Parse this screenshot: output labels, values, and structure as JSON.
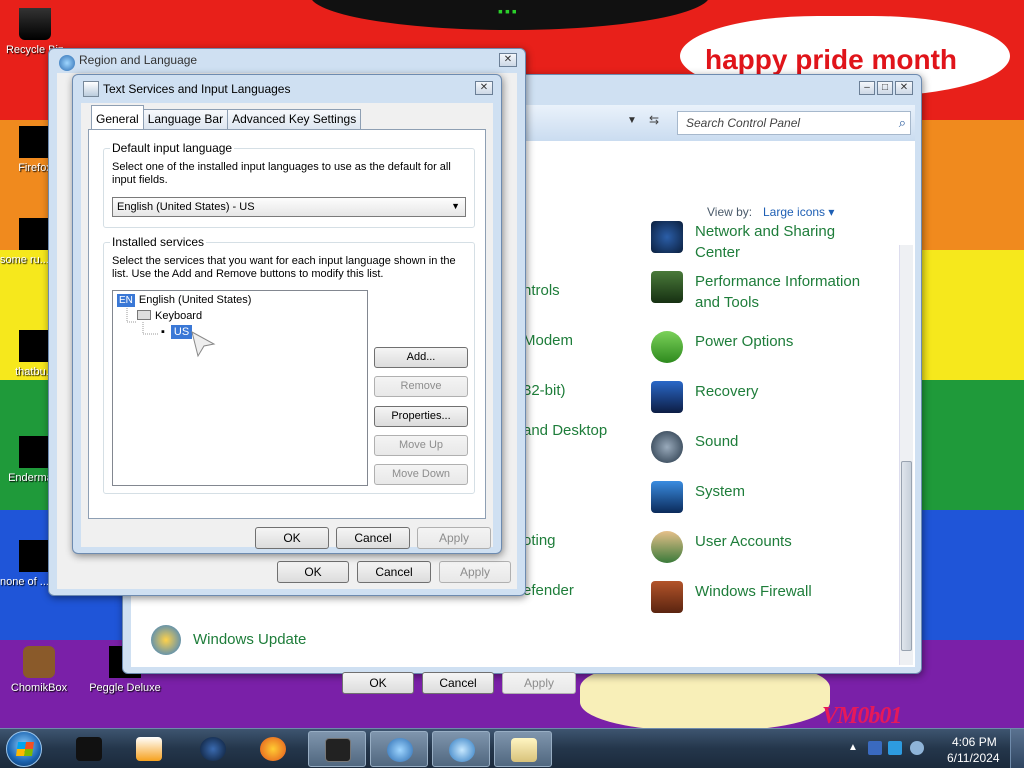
{
  "wallpaper": {
    "speech_text": "happy pride month",
    "tag": "VM0b01"
  },
  "desktop_icons": [
    {
      "label": "Recycle Bin"
    },
    {
      "label": "Firefox"
    },
    {
      "label": "some ru... ran..."
    },
    {
      "label": "thatbu..."
    },
    {
      "label": "Enderma..."
    },
    {
      "label": "none of ... retards kno..."
    },
    {
      "label": "ChomikBox"
    },
    {
      "label": "Peggle Deluxe"
    }
  ],
  "control_panel": {
    "search_placeholder": "Search Control Panel",
    "view_by_label": "View by:",
    "view_by_value": "Large icons",
    "items_right": [
      "Network and Sharing Center",
      "Performance Information and Tools",
      "Power Options",
      "Recovery",
      "Sound",
      "System",
      "User Accounts",
      "Windows Firewall"
    ],
    "items_left_fragments": [
      "ntrols",
      "Modem",
      "32-bit)",
      "and Desktop",
      "oting",
      "efender"
    ],
    "windows_update": "Windows Update",
    "buttons": {
      "ok": "OK",
      "cancel": "Cancel",
      "apply": "Apply"
    }
  },
  "region_language": {
    "title": "Region and Language",
    "buttons": {
      "ok": "OK",
      "cancel": "Cancel",
      "apply": "Apply"
    }
  },
  "text_services": {
    "title": "Text Services and Input Languages",
    "tabs": [
      "General",
      "Language Bar",
      "Advanced Key Settings"
    ],
    "default_group_label": "Default input language",
    "default_group_desc": "Select one of the installed input languages to use as the default for all input fields.",
    "selected_language": "English (United States) - US",
    "installed_group_label": "Installed services",
    "installed_group_desc": "Select the services that you want for each input language shown in the list. Use the Add and Remove buttons to modify this list.",
    "tree": {
      "lang_badge": "EN",
      "language": "English (United States)",
      "category": "Keyboard",
      "layout": "US"
    },
    "side_buttons": {
      "add": "Add...",
      "remove": "Remove",
      "properties": "Properties...",
      "move_up": "Move Up",
      "move_down": "Move Down"
    },
    "buttons": {
      "ok": "OK",
      "cancel": "Cancel",
      "apply": "Apply"
    }
  },
  "taskbar": {
    "time": "4:06 PM",
    "date": "6/11/2024"
  },
  "colors": {
    "link_green": "#1e7d3a",
    "selection_blue": "#3a78d6",
    "speech_red": "#e0141a"
  }
}
